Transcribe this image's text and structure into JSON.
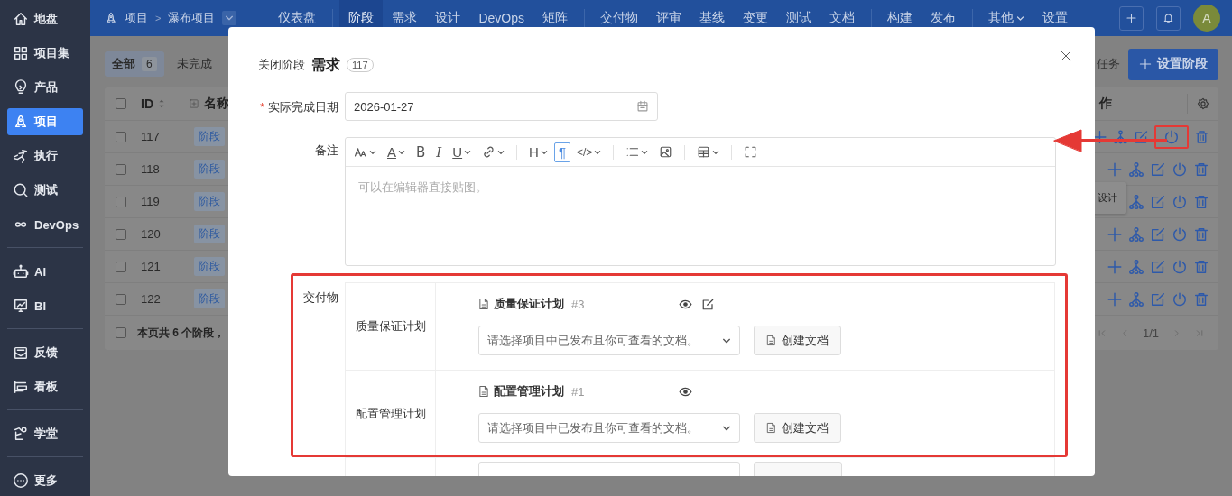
{
  "sidebar": {
    "groups": [
      {
        "items": [
          {
            "label": "地盘",
            "selected": false
          },
          {
            "label": "项目集",
            "selected": false
          },
          {
            "label": "产品",
            "selected": false
          },
          {
            "label": "项目",
            "selected": true
          },
          {
            "label": "执行",
            "selected": false
          },
          {
            "label": "测试",
            "selected": false
          },
          {
            "label": "DevOps",
            "selected": false
          }
        ]
      },
      {
        "items": [
          {
            "label": "AI",
            "selected": false
          },
          {
            "label": "BI",
            "selected": false
          }
        ]
      },
      {
        "items": [
          {
            "label": "反馈",
            "selected": false
          },
          {
            "label": "看板",
            "selected": false
          }
        ]
      },
      {
        "items": [
          {
            "label": "学堂",
            "selected": false
          }
        ]
      },
      {
        "items": [
          {
            "label": "更多",
            "selected": false
          }
        ]
      }
    ]
  },
  "topbar": {
    "breadcrumb": {
      "section": "项目",
      "separator": ">",
      "project": "瀑布项目"
    },
    "nav_groups": [
      [
        {
          "label": "仪表盘",
          "selected": false,
          "dropdown": false
        }
      ],
      [
        {
          "label": "阶段",
          "selected": true,
          "dropdown": false
        },
        {
          "label": "需求",
          "selected": false,
          "dropdown": false
        },
        {
          "label": "设计",
          "selected": false,
          "dropdown": false
        },
        {
          "label": "DevOps",
          "selected": false,
          "dropdown": false
        },
        {
          "label": "矩阵",
          "selected": false,
          "dropdown": false
        }
      ],
      [
        {
          "label": "交付物",
          "selected": false,
          "dropdown": false
        },
        {
          "label": "评审",
          "selected": false,
          "dropdown": false
        },
        {
          "label": "基线",
          "selected": false,
          "dropdown": false
        },
        {
          "label": "变更",
          "selected": false,
          "dropdown": false
        },
        {
          "label": "测试",
          "selected": false,
          "dropdown": false
        },
        {
          "label": "文档",
          "selected": false,
          "dropdown": false
        }
      ],
      [
        {
          "label": "构建",
          "selected": false,
          "dropdown": false
        },
        {
          "label": "发布",
          "selected": false,
          "dropdown": false
        }
      ],
      [
        {
          "label": "其他",
          "selected": false,
          "dropdown": true
        },
        {
          "label": "设置",
          "selected": false,
          "dropdown": false
        }
      ]
    ],
    "avatar": "A"
  },
  "page": {
    "filters": [
      {
        "label": "全部",
        "count": "6",
        "selected": true
      },
      {
        "label": "未完成",
        "selected": false
      }
    ],
    "task_button": "任务",
    "primary_button": "设置阶段",
    "table": {
      "select_all_checked": false,
      "columns": [
        "ID",
        "名称",
        "作"
      ],
      "rows": [
        {
          "checked": false,
          "id": "117",
          "tag": "阶段",
          "highlighted": true
        },
        {
          "checked": false,
          "id": "118",
          "tag": "阶段",
          "highlighted": false
        },
        {
          "checked": false,
          "id": "119",
          "tag": "阶段",
          "highlighted": false,
          "tooltip": "设计"
        },
        {
          "checked": false,
          "id": "120",
          "tag": "阶段",
          "highlighted": false
        },
        {
          "checked": false,
          "id": "121",
          "tag": "阶段",
          "highlighted": false
        },
        {
          "checked": false,
          "id": "122",
          "tag": "阶段",
          "highlighted": false
        }
      ],
      "footer_checked": false,
      "footer": "本页共 6 个阶段，",
      "pager": "1/1"
    }
  },
  "modal": {
    "title": "关闭阶段",
    "stage": "需求",
    "stage_id": "117",
    "date": {
      "label": "实际完成日期",
      "required_mark": "*",
      "value": "2026-01-27"
    },
    "note": {
      "label": "备注",
      "placeholder": "可以在编辑器直接贴图。",
      "tools": [
        {
          "kind": "font-size",
          "dropdown": true,
          "selected": false
        },
        {
          "kind": "color",
          "glyph": "A",
          "dropdown": true,
          "selected": false
        },
        {
          "kind": "bold",
          "glyph": "B",
          "dropdown": false,
          "selected": false
        },
        {
          "kind": "italic",
          "glyph": "I",
          "dropdown": false,
          "selected": false
        },
        {
          "kind": "underline",
          "glyph": "U",
          "dropdown": true,
          "selected": false
        },
        {
          "kind": "link",
          "dropdown": true,
          "selected": false
        },
        {
          "kind": "separator"
        },
        {
          "kind": "heading",
          "glyph": "H",
          "dropdown": true,
          "selected": false
        },
        {
          "kind": "paragraph",
          "glyph": "¶",
          "dropdown": false,
          "selected": true
        },
        {
          "kind": "code",
          "glyph": "</>",
          "dropdown": true,
          "selected": false
        },
        {
          "kind": "separator"
        },
        {
          "kind": "list",
          "dropdown": true,
          "selected": false
        },
        {
          "kind": "image",
          "dropdown": false,
          "selected": false
        },
        {
          "kind": "separator"
        },
        {
          "kind": "table",
          "dropdown": true,
          "selected": false
        },
        {
          "kind": "separator"
        },
        {
          "kind": "fullscreen",
          "dropdown": false,
          "selected": false
        }
      ]
    },
    "deliverables": {
      "label": "交付物",
      "highlighted": true,
      "rows": [
        {
          "kind": "item",
          "name": "质量保证计划",
          "doc": {
            "title": "质量保证计划",
            "number": "#3",
            "editable": true
          },
          "placeholder": "请选择项目中已发布且你可查看的文档。",
          "button": "创建文档"
        },
        {
          "kind": "item",
          "name": "配置管理计划",
          "doc": {
            "title": "配置管理计划",
            "number": "#1",
            "editable": false
          },
          "placeholder": "请选择项目中已发布且你可查看的文档。",
          "button": "创建文档"
        },
        {
          "kind": "cut"
        }
      ]
    }
  }
}
